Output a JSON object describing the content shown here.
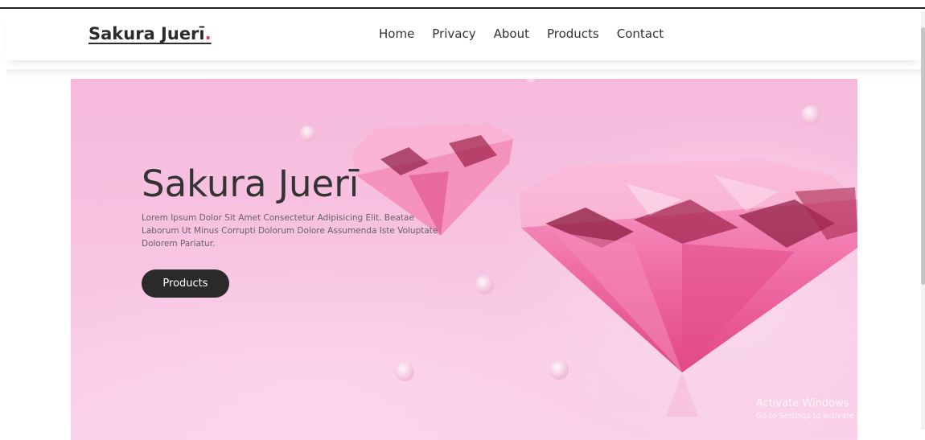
{
  "header": {
    "logo_text": "Sakura Juerī",
    "logo_dot": ".",
    "nav": [
      "Home",
      "Privacy",
      "About",
      "Products",
      "Contact"
    ]
  },
  "hero": {
    "title": "Sakura Juerī",
    "description": "Lorem Ipsum Dolor Sit Amet Consectetur Adipisicing Elit. Beatae Laborum Ut Minus Corrupti Dolorum Dolore Assumenda Iste Voluptate Dolorem Pariatur.",
    "button_label": "Products",
    "image": "pink-diamonds-with-water-droplets"
  },
  "watermark": {
    "title": "Activate Windows",
    "subtitle": "Go to Settings to activate Windows."
  },
  "colors": {
    "accent": "#e8386f",
    "button_bg": "#2a2a2a",
    "hero_bg": "#f6b9dc"
  }
}
